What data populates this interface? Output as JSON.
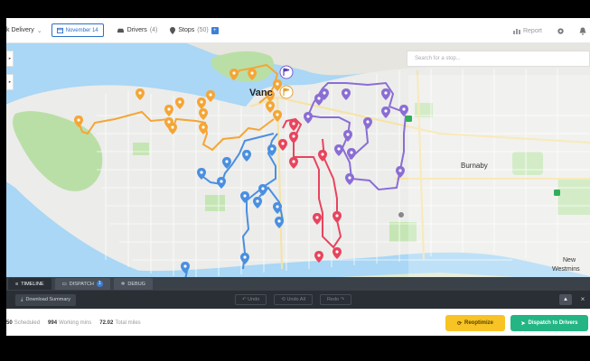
{
  "header": {
    "app_menu": "k Delivery",
    "date": "November 14",
    "drivers_label": "Drivers",
    "drivers_count": "(4)",
    "stops_label": "Stops",
    "stops_count": "(50)",
    "report": "Report"
  },
  "map": {
    "search_placeholder": "Search for a stop...",
    "labels": {
      "vancouver": "Vanc",
      "burnaby": "Burnaby",
      "new_westminster_1": "New",
      "new_westminster_2": "Westmins"
    },
    "routes": [
      {
        "color": "#f5a535"
      },
      {
        "color": "#4a8fe0"
      },
      {
        "color": "#e8445e"
      },
      {
        "color": "#8a6dd4"
      }
    ]
  },
  "panel": {
    "tabs": [
      {
        "label": "TIMELINE"
      },
      {
        "label": "DISPATCH",
        "badge": "1"
      },
      {
        "label": "DEBUG"
      }
    ],
    "download_label": "Download Summary",
    "undo": "Undo",
    "undo_all": "Undo All",
    "redo": "Redo"
  },
  "status": {
    "scheduled_value": "50",
    "scheduled_label": "Scheduled",
    "working_value": "994",
    "working_label": "Working mins",
    "miles_value": "72.02",
    "miles_label": "Total miles",
    "reoptimize": "Reoptimize",
    "dispatch": "Dispatch to Drivers"
  },
  "colors": {
    "accent": "#2d6fc9",
    "reoptimize_bg": "#f7c325",
    "dispatch_bg": "#24b584"
  }
}
